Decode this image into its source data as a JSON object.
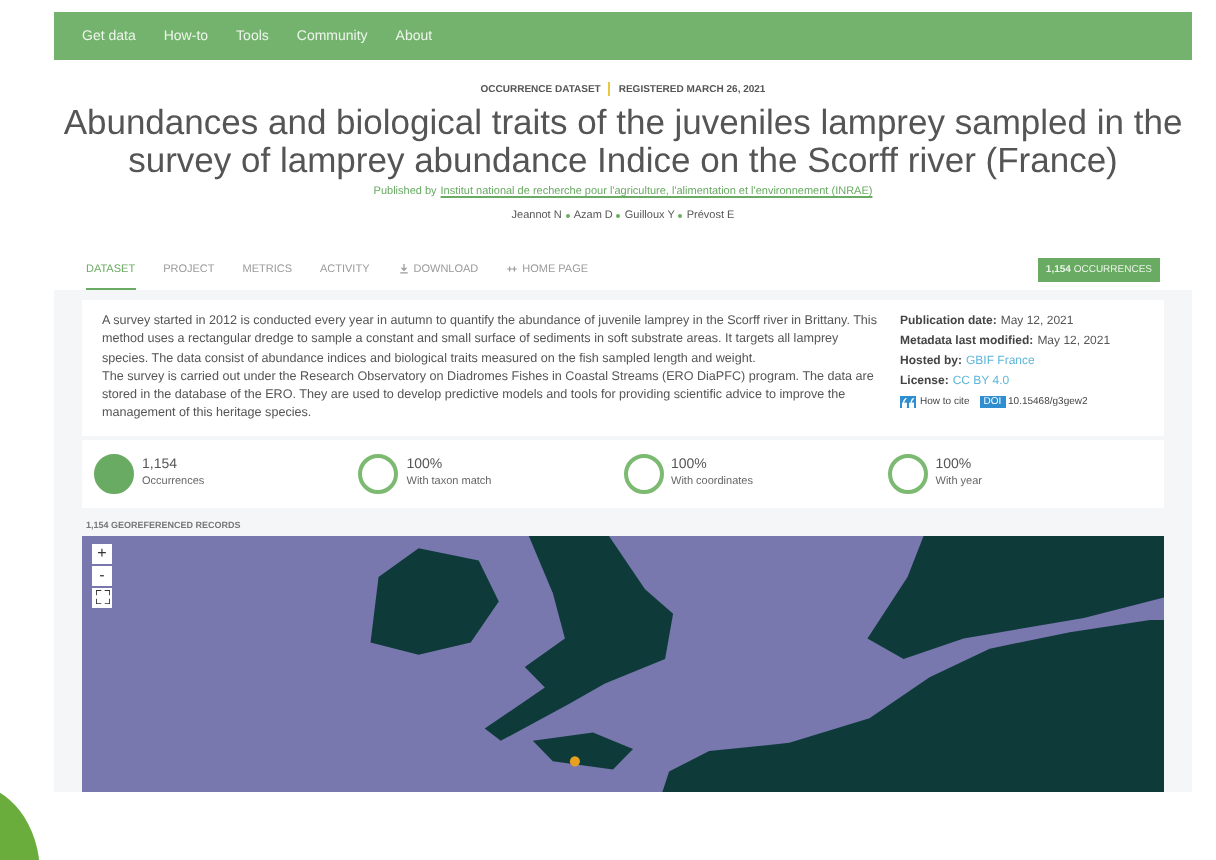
{
  "nav": [
    "Get data",
    "How-to",
    "Tools",
    "Community",
    "About"
  ],
  "header": {
    "type": "OCCURRENCE DATASET",
    "registered": "REGISTERED MARCH 26, 2021",
    "title": "Abundances and biological traits of the juveniles lamprey sampled in the survey of lamprey abundance Indice on the Scorff river (France)",
    "published_by": "Published by",
    "publisher": "Institut national de recherche pour l'agriculture, l'alimentation et l'environnement (INRAE)",
    "authors": [
      "Jeannot N",
      "Azam D",
      "Guilloux Y",
      "Prévost E"
    ]
  },
  "tabs": [
    {
      "label": "DATASET",
      "selected": true,
      "kind": "plain"
    },
    {
      "label": "PROJECT",
      "selected": false,
      "kind": "plain"
    },
    {
      "label": "METRICS",
      "selected": false,
      "kind": "plain"
    },
    {
      "label": "ACTIVITY",
      "selected": false,
      "kind": "plain"
    },
    {
      "label": "DOWNLOAD",
      "selected": false,
      "kind": "download"
    },
    {
      "label": "HOME PAGE",
      "selected": false,
      "kind": "link"
    }
  ],
  "occurrences_button": {
    "count": "1,154",
    "label": "OCCURRENCES"
  },
  "description": [
    "A survey started in 2012 is conducted every year in autumn to quantify the abundance of juvenile lamprey in the Scorff river in Brittany. This method uses a rectangular dredge to sample a constant and small surface of sediments in soft substrate areas. It targets all lamprey species. The data consist of abundance indices and biological traits measured on the fish sampled length and weight.",
    "The survey is carried out under the Research Observatory on Diadromes Fishes in Coastal Streams (ERO DiaPFC) program. The data are stored in the database of the ERO. They are used to develop predictive models and tools for providing scientific advice to improve the management of this heritage species."
  ],
  "metadata": [
    {
      "label": "Publication date:",
      "value": "May 12, 2021",
      "link": false
    },
    {
      "label": "Metadata last modified:",
      "value": "May 12, 2021",
      "link": false
    },
    {
      "label": "Hosted by:",
      "value": "GBIF France",
      "link": true
    },
    {
      "label": "License:",
      "value": "CC BY 4.0",
      "link": true
    }
  ],
  "cite": {
    "label": "How to cite",
    "doi_badge": "DOI",
    "doi": "10.15468/g3gew2"
  },
  "stats": [
    {
      "value": "1,154",
      "label": "Occurrences",
      "filled": true
    },
    {
      "value": "100%",
      "label": "With taxon match",
      "filled": false
    },
    {
      "value": "100%",
      "label": "With coordinates",
      "filled": false
    },
    {
      "value": "100%",
      "label": "With year",
      "filled": false
    }
  ],
  "map": {
    "heading": "1,154 GEOREFERENCED RECORDS",
    "zoom_in": "+",
    "zoom_out": "-"
  }
}
